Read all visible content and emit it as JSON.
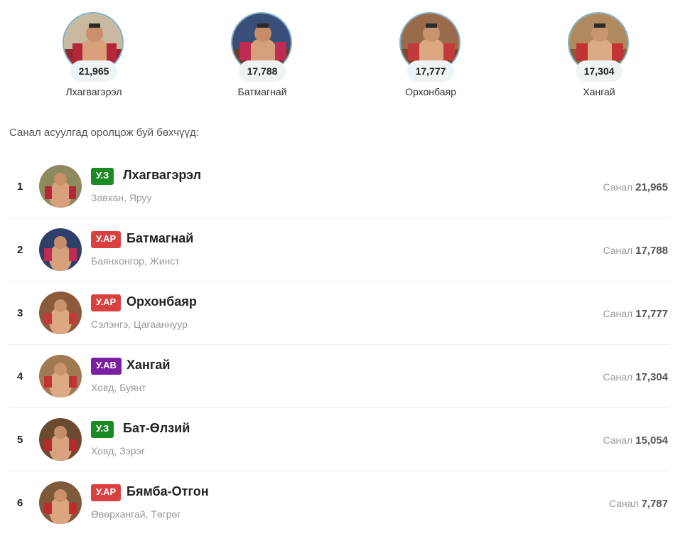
{
  "colors": {
    "badge_uz": "#1a8a23",
    "badge_uar": "#d94141",
    "badge_uav": "#7b1fa2"
  },
  "top": [
    {
      "name": "Лхагвагэрэл",
      "votes": "21,965"
    },
    {
      "name": "Батмагнай",
      "votes": "17,788"
    },
    {
      "name": "Орхонбаяр",
      "votes": "17,777"
    },
    {
      "name": "Хангай",
      "votes": "17,304"
    }
  ],
  "intro": "Санал асуулгад оролцож буй бөхчүүд:",
  "vote_label": "Санал",
  "list": [
    {
      "rank": "1",
      "badge": "У.З",
      "badge_type": "uz",
      "name": "Лхагвагэрэл",
      "location": "Завхан, Яруу",
      "votes": "21,965"
    },
    {
      "rank": "2",
      "badge": "У.АР",
      "badge_type": "uar",
      "name": "Батмагнай",
      "location": "Баянхонгор, Жинст",
      "votes": "17,788"
    },
    {
      "rank": "3",
      "badge": "У.АР",
      "badge_type": "uar",
      "name": "Орхонбаяр",
      "location": "Сэлэнгэ, Цагааннуур",
      "votes": "17,777"
    },
    {
      "rank": "4",
      "badge": "У.АВ",
      "badge_type": "uav",
      "name": "Хангай",
      "location": "Ховд, Буянт",
      "votes": "17,304"
    },
    {
      "rank": "5",
      "badge": "У.З",
      "badge_type": "uz",
      "name": "Бат-Өлзий",
      "location": "Ховд, Зэрэг",
      "votes": "15,054"
    },
    {
      "rank": "6",
      "badge": "У.АР",
      "badge_type": "uar",
      "name": "Бямба-Отгон",
      "location": "Өвөрхангай, Төгрөг",
      "votes": "7,787"
    }
  ]
}
